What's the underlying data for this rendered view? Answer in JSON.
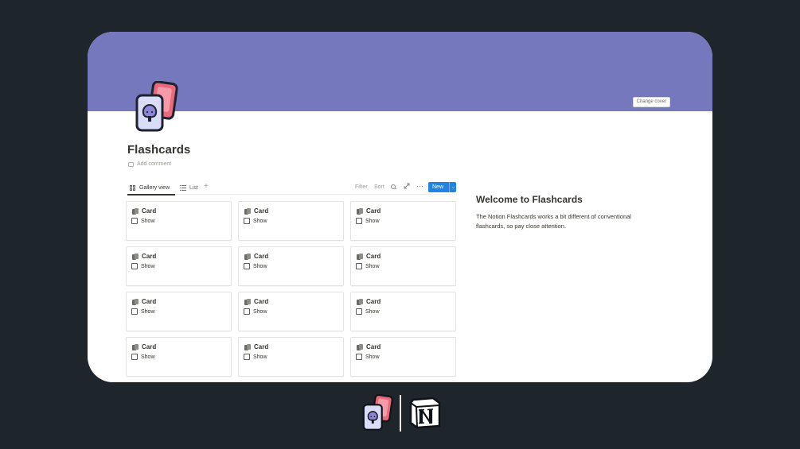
{
  "page": {
    "cover_button": "Change cover",
    "title": "Flashcards",
    "add_comment": "Add comment"
  },
  "toolbar": {
    "tabs": [
      "Gallery view",
      "List"
    ],
    "add": "+",
    "filter": "Filter",
    "sort": "Sort",
    "more": "⋯",
    "new_button": "New",
    "new_chevron": "⌄"
  },
  "cards": [
    {
      "title": "Card",
      "property": "Show"
    },
    {
      "title": "Card",
      "property": "Show"
    },
    {
      "title": "Card",
      "property": "Show"
    },
    {
      "title": "Card",
      "property": "Show"
    },
    {
      "title": "Card",
      "property": "Show"
    },
    {
      "title": "Card",
      "property": "Show"
    },
    {
      "title": "Card",
      "property": "Show"
    },
    {
      "title": "Card",
      "property": "Show"
    },
    {
      "title": "Card",
      "property": "Show"
    },
    {
      "title": "Card",
      "property": "Show"
    },
    {
      "title": "Card",
      "property": "Show"
    },
    {
      "title": "Card",
      "property": "Show"
    }
  ],
  "welcome": {
    "heading": "Welcome to Flashcards",
    "body": "The Notion Flashcards works a bit different of conventional flashcards, so pay close attention."
  },
  "colors": {
    "background": "#1e252b",
    "cover": "#7578bc",
    "accent": "#2383e2"
  },
  "icons": {
    "page": "flashcards-icon",
    "footer": [
      "flashcards-icon",
      "notion-logo"
    ]
  }
}
